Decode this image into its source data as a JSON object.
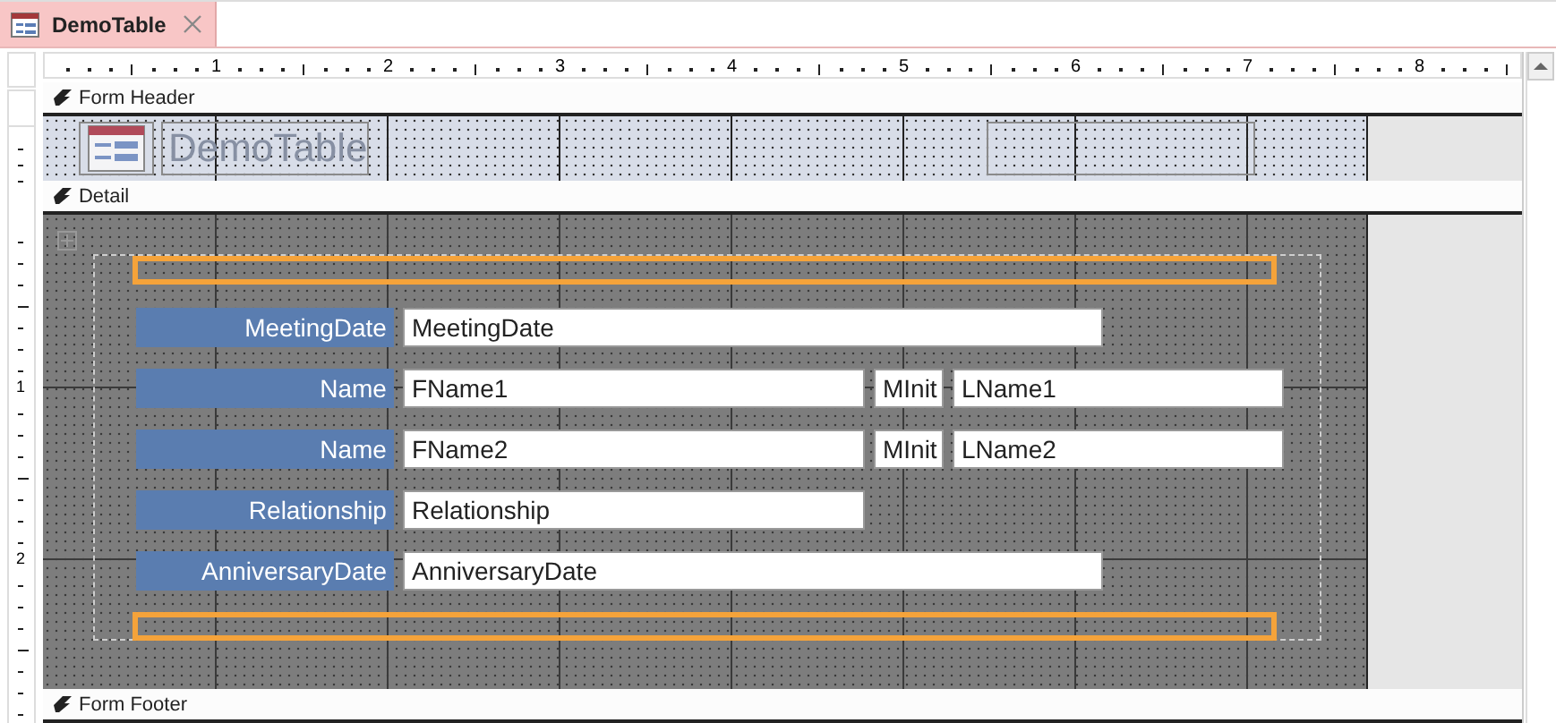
{
  "tabs": [
    {
      "label": "DemoTable",
      "selected": true
    }
  ],
  "ruler": {
    "numbers": [
      "1",
      "2",
      "3",
      "4",
      "5",
      "6",
      "7",
      "8"
    ]
  },
  "vertical_ruler": {
    "numbers": [
      "1",
      "2"
    ]
  },
  "form_header": {
    "label": "Form Header",
    "title": "DemoTable"
  },
  "detail": {
    "label": "Detail",
    "rows": [
      {
        "label": "MeetingDate",
        "fields": [
          "MeetingDate"
        ]
      },
      {
        "label": "Name",
        "fields": [
          "FName1",
          "MInit",
          "LName1"
        ]
      },
      {
        "label": "Name",
        "fields": [
          "FName2",
          "MInit",
          "LName2"
        ]
      },
      {
        "label": "Relationship",
        "fields": [
          "Relationship"
        ]
      },
      {
        "label": "AnniversaryDate",
        "fields": [
          "AnniversaryDate"
        ]
      }
    ]
  },
  "form_footer": {
    "label": "Form Footer"
  }
}
